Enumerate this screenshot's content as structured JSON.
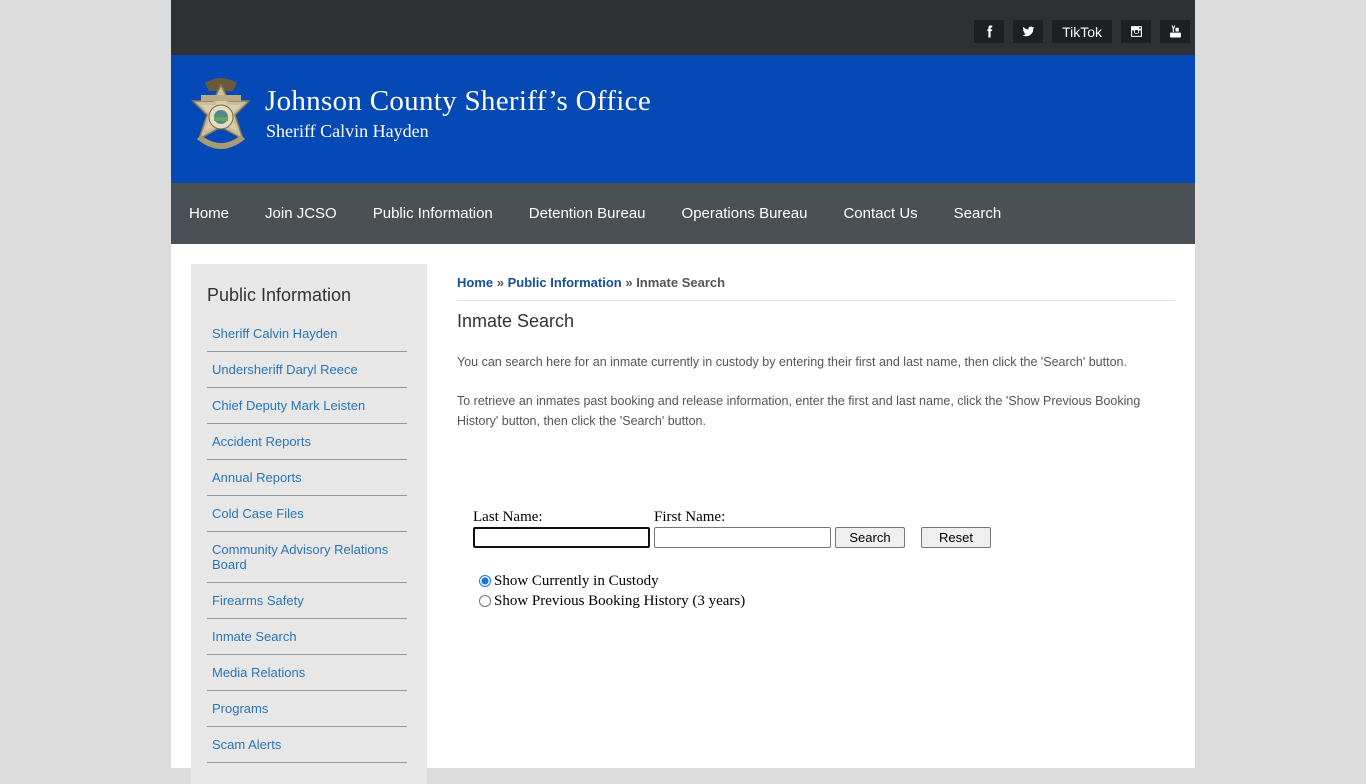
{
  "social": {
    "facebook_icon": "facebook-icon",
    "twitter_icon": "twitter-icon",
    "tiktok_label": "TikTok",
    "instagram_icon": "instagram-icon",
    "youtube_icon": "youtube-icon"
  },
  "banner": {
    "title": "Johnson County Sheriff’s Office",
    "subtitle": "Sheriff Calvin Hayden",
    "badge_icon": "sheriff-badge-logo"
  },
  "nav": {
    "items": [
      {
        "label": "Home"
      },
      {
        "label": "Join JCSO"
      },
      {
        "label": "Public Information"
      },
      {
        "label": "Detention Bureau"
      },
      {
        "label": "Operations Bureau"
      },
      {
        "label": "Contact Us"
      },
      {
        "label": "Search"
      }
    ]
  },
  "sidebar": {
    "heading": "Public Information",
    "items": [
      {
        "label": "Sheriff Calvin Hayden"
      },
      {
        "label": "Undersheriff Daryl Reece"
      },
      {
        "label": "Chief Deputy Mark Leisten"
      },
      {
        "label": "Accident Reports"
      },
      {
        "label": "Annual Reports"
      },
      {
        "label": "Cold Case Files"
      },
      {
        "label": "Community Advisory Relations Board"
      },
      {
        "label": "Firearms Safety"
      },
      {
        "label": "Inmate Search"
      },
      {
        "label": "Media Relations"
      },
      {
        "label": "Programs"
      },
      {
        "label": "Scam Alerts"
      }
    ]
  },
  "breadcrumb": {
    "home": "Home",
    "sep1": " » ",
    "section": "Public Information",
    "sep2": " » ",
    "current": "Inmate Search"
  },
  "main": {
    "title": "Inmate Search",
    "paragraph1": "You can search here for an inmate currently in custody by entering their first and last name, then click the 'Search' button.",
    "paragraph2": "To retrieve an inmates past booking and release information, enter the first and last name, click the 'Show Previous Booking History' button, then click the 'Search' button."
  },
  "form": {
    "last_name_label": "Last Name:",
    "last_name_value": "",
    "first_name_label": "First Name:",
    "first_name_value": "",
    "search_label": "Search",
    "reset_label": "Reset",
    "radio_current_label": "Show Currently in Custody",
    "radio_current_checked": true,
    "radio_history_label": "Show Previous Booking History (3 years)",
    "radio_history_checked": false
  }
}
